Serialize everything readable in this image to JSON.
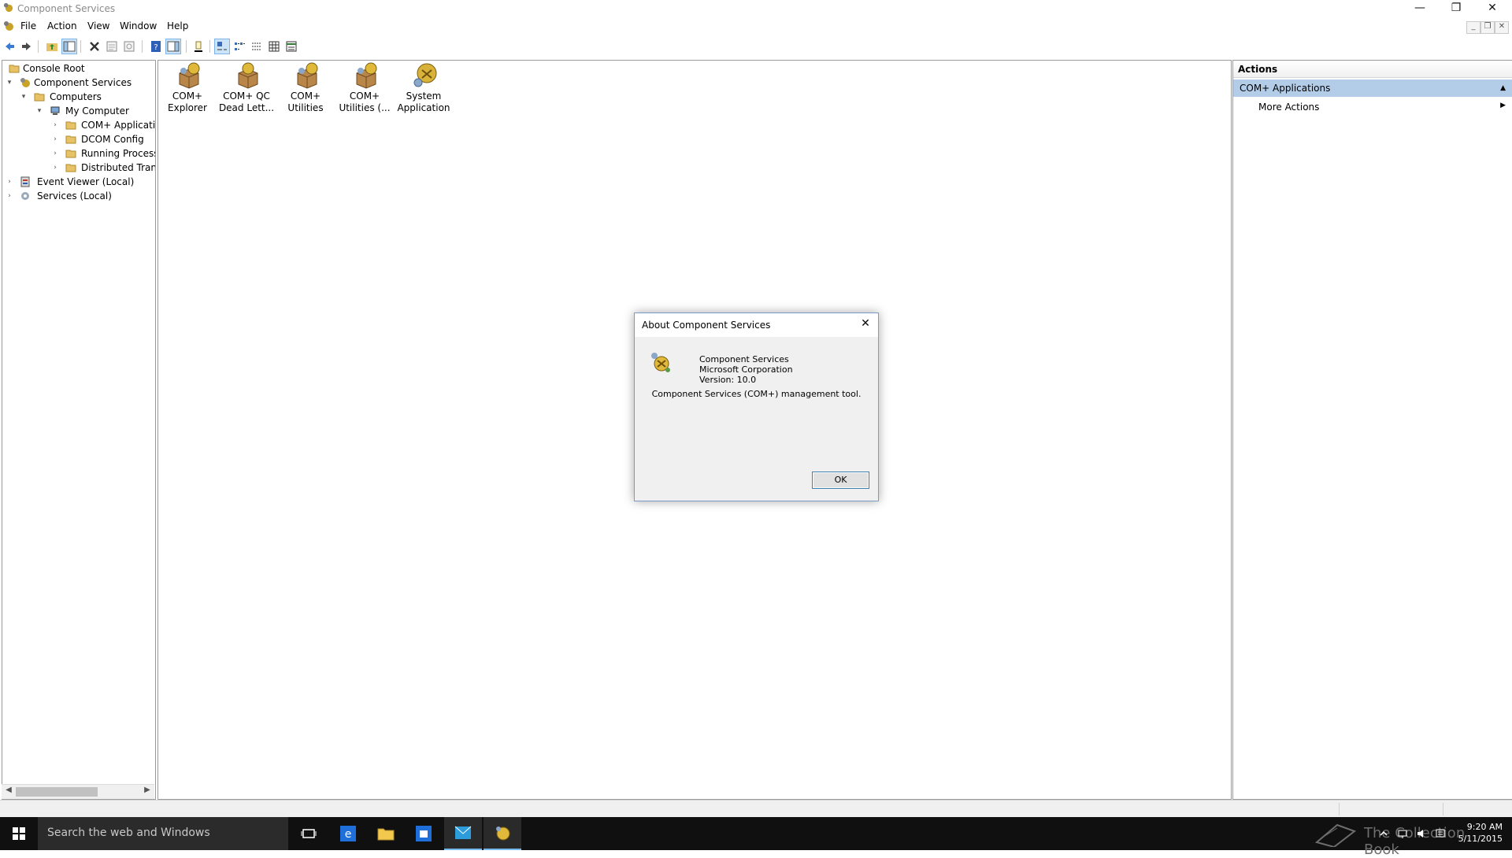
{
  "window": {
    "title": "Component Services",
    "controls": {
      "minimize": "—",
      "restore": "❐",
      "close": "✕"
    }
  },
  "menu": {
    "items": [
      "File",
      "Action",
      "View",
      "Window",
      "Help"
    ]
  },
  "tree": {
    "nodes": [
      {
        "label": "Console Root",
        "expander": ""
      },
      {
        "label": "Component Services",
        "expander": "▾"
      },
      {
        "label": "Computers",
        "expander": "▾"
      },
      {
        "label": "My Computer",
        "expander": "▾"
      },
      {
        "label": "COM+ Applications",
        "expander": "›"
      },
      {
        "label": "DCOM Config",
        "expander": "›"
      },
      {
        "label": "Running Processes",
        "expander": "›"
      },
      {
        "label": "Distributed Transaction Coordinator",
        "expander": "›"
      },
      {
        "label": "Event Viewer (Local)",
        "expander": "›"
      },
      {
        "label": "Services (Local)",
        "expander": "›"
      }
    ]
  },
  "center": {
    "items": [
      {
        "line1": "COM+",
        "line2": "Explorer"
      },
      {
        "line1": "COM+ QC",
        "line2": "Dead Lett..."
      },
      {
        "line1": "COM+",
        "line2": "Utilities"
      },
      {
        "line1": "COM+",
        "line2": "Utilities (..."
      },
      {
        "line1": "System",
        "line2": "Application"
      }
    ]
  },
  "actions": {
    "header": "Actions",
    "section": "COM+ Applications",
    "more": "More Actions"
  },
  "dialog": {
    "title": "About Component Services",
    "product": "Component Services",
    "company": "Microsoft Corporation",
    "version": "Version: 10.0",
    "description": "Component Services (COM+) management tool.",
    "ok": "OK"
  },
  "taskbar": {
    "search_placeholder": "Search the web and Windows",
    "watermark": "The Collection Book",
    "time": "9:20 AM",
    "date": "5/11/2015"
  },
  "colors": {
    "selection": "#b3cde8",
    "taskbar": "#101010",
    "accent": "#76b9ed",
    "icon_gold": "#c9a227"
  }
}
